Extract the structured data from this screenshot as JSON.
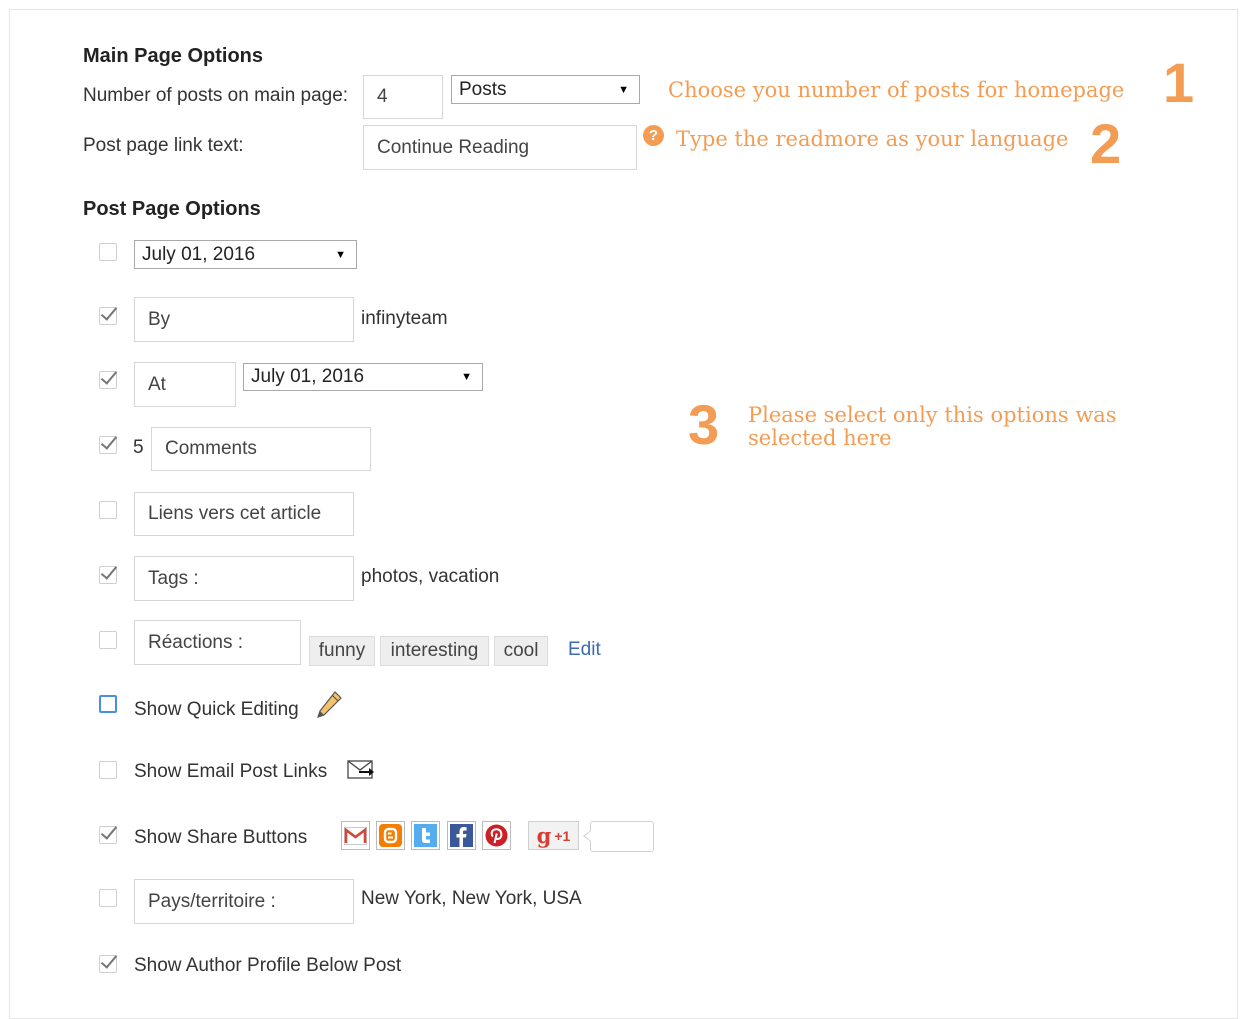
{
  "main_options": {
    "heading": "Main Page Options",
    "posts_count_label": "Number of posts on main page:",
    "posts_count_value": "4",
    "posts_type_value": "Posts",
    "link_text_label": "Post page link text:",
    "link_text_value": "Continue Reading"
  },
  "post_options": {
    "heading": "Post Page Options",
    "date_value": "July 01, 2016",
    "by_value": "By",
    "author": "infinyteam",
    "at_value": "At",
    "time_value": "July 01, 2016",
    "comments_count": "5",
    "comments_value": "Comments",
    "links_value": "Liens vers cet article",
    "tags_value": "Tags :",
    "tags_sample": "photos, vacation",
    "reactions_value": "Réactions :",
    "reaction_tags": [
      "funny",
      "interesting",
      "cool"
    ],
    "edit_label": "Edit",
    "quick_edit_label": "Show Quick Editing",
    "email_links_label": "Show Email Post Links",
    "share_label": "Show Share Buttons",
    "plus_one": "+1",
    "location_value": "Pays/territoire :",
    "location_sample": "New York, New York, USA",
    "author_profile_label": "Show Author Profile Below Post"
  },
  "annotations": {
    "note1": "Choose you number of posts for homepage",
    "num1": "1",
    "note2": "Type the readmore as your language",
    "num2": "2",
    "help_glyph": "?",
    "note3_line1": "Please select only this options was",
    "note3_line2": "selected here",
    "num3": "3"
  },
  "checkboxes": {
    "date": false,
    "author": true,
    "time": true,
    "comments": true,
    "links": false,
    "tags": true,
    "reactions": false,
    "quick_edit": false,
    "email": false,
    "share": true,
    "location": false,
    "author_profile": true
  },
  "share_buttons": [
    "gmail-icon",
    "blogger-icon",
    "twitter-icon",
    "facebook-icon",
    "pinterest-icon",
    "google-plus-icon"
  ],
  "colors": {
    "accent": "#f39c53",
    "link": "#3b6bb5"
  }
}
